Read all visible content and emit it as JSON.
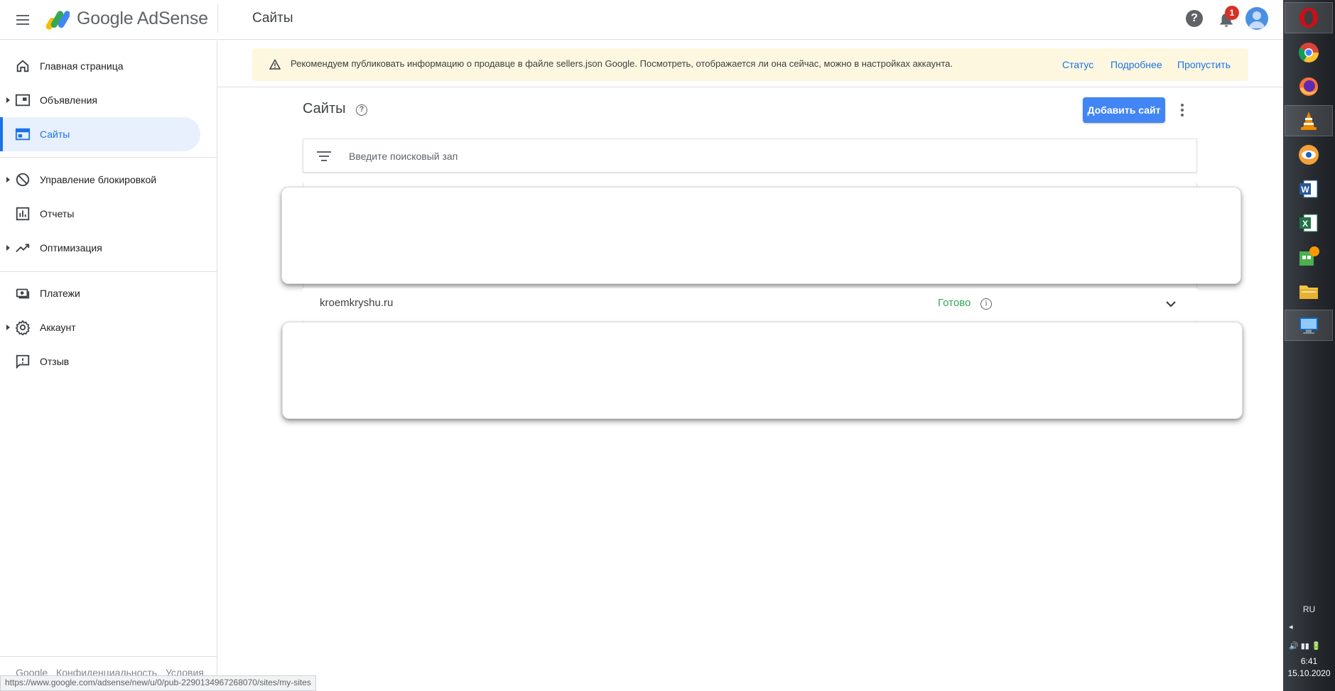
{
  "header": {
    "brand": "Google AdSense",
    "page_title": "Сайты",
    "notification_count": "1"
  },
  "sidebar": {
    "items": [
      {
        "label": "Главная страница",
        "icon": "home-icon"
      },
      {
        "label": "Объявления",
        "icon": "ads-icon",
        "expandable": true
      },
      {
        "label": "Сайты",
        "icon": "sites-icon",
        "active": true
      },
      {
        "label": "Управление блокировкой",
        "icon": "block-icon",
        "expandable": true
      },
      {
        "label": "Отчеты",
        "icon": "reports-icon"
      },
      {
        "label": "Оптимизация",
        "icon": "optimization-icon",
        "expandable": true
      },
      {
        "label": "Платежи",
        "icon": "payments-icon"
      },
      {
        "label": "Аккаунт",
        "icon": "gear-icon",
        "expandable": true
      },
      {
        "label": "Отзыв",
        "icon": "feedback-icon"
      }
    ],
    "footer": {
      "google": "Google",
      "privacy": "Конфиденциальность",
      "terms": "Условия"
    }
  },
  "status_url": "https://www.google.com/adsense/new/u/0/pub-2290134967268070/sites/my-sites",
  "banner": {
    "message": "Рекомендуем публиковать информацию о продавце в файле sellers.json Google. Посмотреть, отображается ли она сейчас, можно в настройках аккаунта.",
    "status": "Статус",
    "details": "Подробнее",
    "skip": "Пропустить"
  },
  "sites": {
    "title": "Сайты",
    "add_button": "Добавить сайт",
    "search_placeholder": "Введите поисковый зап",
    "rows": [
      {
        "domain": "kroemkryshu.ru",
        "status": "Готово"
      }
    ]
  },
  "taskbar": {
    "apps": [
      "opera-icon",
      "chrome-icon",
      "firefox-icon",
      "vlc-icon",
      "eye-app-icon",
      "word-icon",
      "excel-icon",
      "calendar-app-icon",
      "folder-icon",
      "monitor-icon"
    ],
    "language": "RU",
    "time": "6:41",
    "date": "15.10.2020"
  },
  "colors": {
    "accent": "#1a73e8",
    "primary_button": "#4285f4",
    "banner_bg": "#fef7e0",
    "status_ready": "#34a853",
    "badge": "#d93025"
  }
}
